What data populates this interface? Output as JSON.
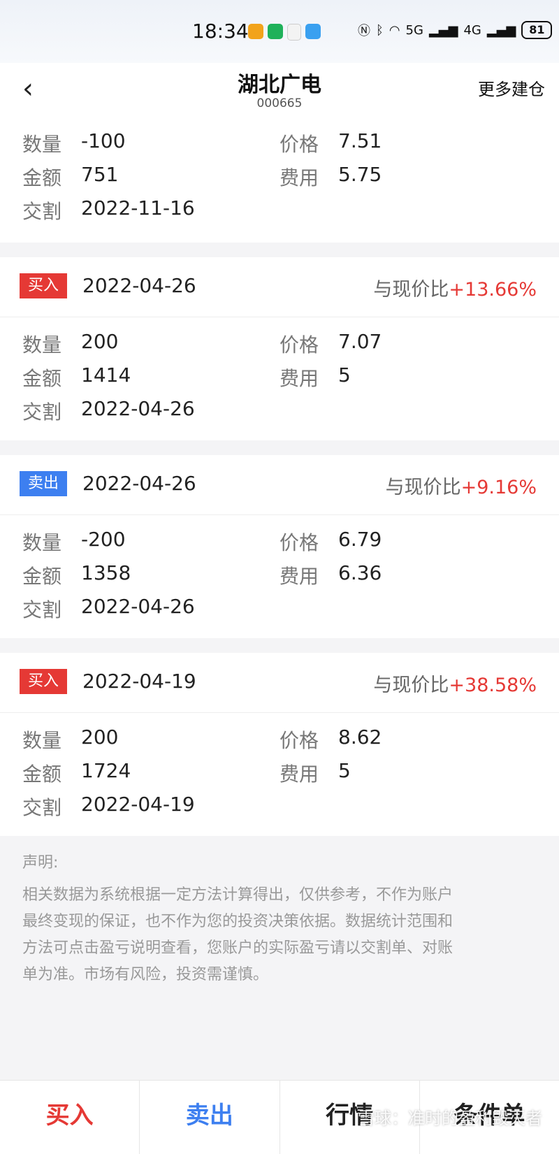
{
  "status": {
    "time": "18:34",
    "net5g": "5G",
    "net4g": "4G",
    "battery": "81"
  },
  "nav": {
    "title": "湖北广电",
    "code": "000665",
    "more": "更多建仓"
  },
  "labels": {
    "qty": "数量",
    "price": "价格",
    "amount": "金额",
    "fee": "费用",
    "settle": "交割",
    "compare": "与现价比"
  },
  "first": {
    "qty": "-100",
    "price": "7.51",
    "amount": "751",
    "fee": "5.75",
    "settle": "2022-11-16"
  },
  "trades": [
    {
      "type": "买入",
      "date": "2022-04-26",
      "pct": "+13.66%",
      "qty": "200",
      "price": "7.07",
      "amount": "1414",
      "fee": "5",
      "settle": "2022-04-26"
    },
    {
      "type": "卖出",
      "date": "2022-04-26",
      "pct": "+9.16%",
      "qty": "-200",
      "price": "6.79",
      "amount": "1358",
      "fee": "6.36",
      "settle": "2022-04-26"
    },
    {
      "type": "买入",
      "date": "2022-04-19",
      "pct": "+38.58%",
      "qty": "200",
      "price": "8.62",
      "amount": "1724",
      "fee": "5",
      "settle": "2022-04-19"
    }
  ],
  "disclaimer": {
    "title": "声明:",
    "line1": "相关数据为系统根据一定方法计算得出，仅供参考，不作为账户",
    "line2": "最终变现的保证，也不作为您的投资决策依据。数据统计范围和",
    "line3": "方法可点击盈亏说明查看，您账户的实际盈亏请以交割单、对账",
    "line4": "单为准。市场有风险，投资需谨慎。"
  },
  "tabs": {
    "buy": "买入",
    "sell": "卖出",
    "market": "行情",
    "conditional": "条件单"
  },
  "watermark": "雪球：准时的盈利毁灭者",
  "colors": {
    "buy": "#e53935",
    "sell": "#3d7ff0"
  }
}
